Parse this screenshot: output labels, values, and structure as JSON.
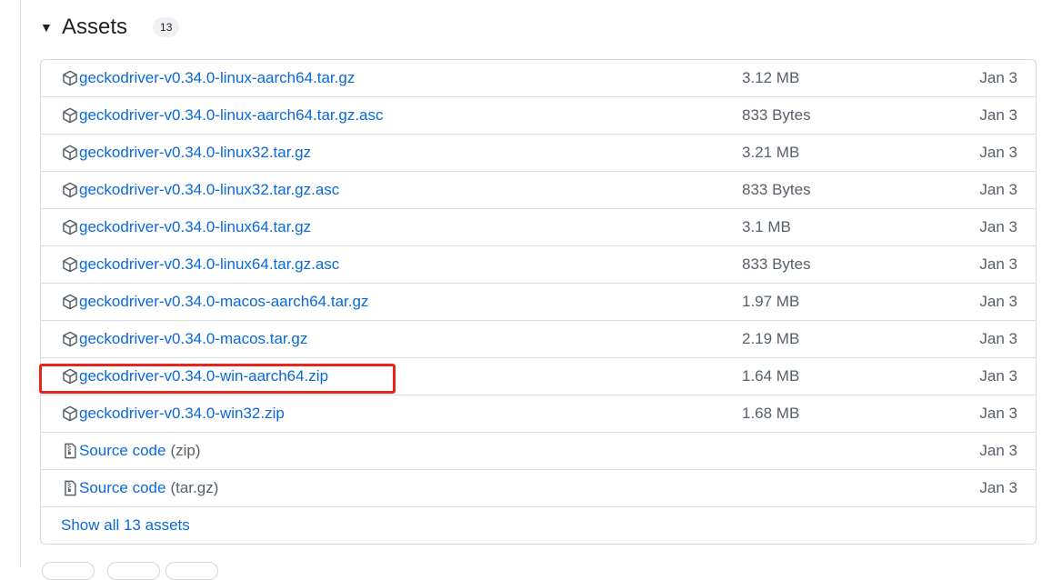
{
  "header": {
    "title": "Assets",
    "count": "13"
  },
  "assets": [
    {
      "name": "geckodriver-v0.34.0-linux-aarch64.tar.gz",
      "size": "3.12 MB",
      "date": "Jan 3",
      "icon": "package-icon"
    },
    {
      "name": "geckodriver-v0.34.0-linux-aarch64.tar.gz.asc",
      "size": "833 Bytes",
      "date": "Jan 3",
      "icon": "package-icon"
    },
    {
      "name": "geckodriver-v0.34.0-linux32.tar.gz",
      "size": "3.21 MB",
      "date": "Jan 3",
      "icon": "package-icon"
    },
    {
      "name": "geckodriver-v0.34.0-linux32.tar.gz.asc",
      "size": "833 Bytes",
      "date": "Jan 3",
      "icon": "package-icon"
    },
    {
      "name": "geckodriver-v0.34.0-linux64.tar.gz",
      "size": "3.1 MB",
      "date": "Jan 3",
      "icon": "package-icon"
    },
    {
      "name": "geckodriver-v0.34.0-linux64.tar.gz.asc",
      "size": "833 Bytes",
      "date": "Jan 3",
      "icon": "package-icon"
    },
    {
      "name": "geckodriver-v0.34.0-macos-aarch64.tar.gz",
      "size": "1.97 MB",
      "date": "Jan 3",
      "icon": "package-icon"
    },
    {
      "name": "geckodriver-v0.34.0-macos.tar.gz",
      "size": "2.19 MB",
      "date": "Jan 3",
      "icon": "package-icon"
    },
    {
      "name": "geckodriver-v0.34.0-win-aarch64.zip",
      "size": "1.64 MB",
      "date": "Jan 3",
      "icon": "package-icon"
    },
    {
      "name": "geckodriver-v0.34.0-win32.zip",
      "size": "1.68 MB",
      "date": "Jan 3",
      "icon": "package-icon"
    },
    {
      "name": "Source code",
      "suffix": "(zip)",
      "size": "",
      "date": "Jan 3",
      "icon": "file-zip-icon"
    },
    {
      "name": "Source code",
      "suffix": "(tar.gz)",
      "size": "",
      "date": "Jan 3",
      "icon": "file-zip-icon"
    }
  ],
  "show_all_label": "Show all 13 assets",
  "colors": {
    "link": "#0969da",
    "muted": "#57606a",
    "highlight": "#e8241c",
    "border": "#d0d7de"
  }
}
